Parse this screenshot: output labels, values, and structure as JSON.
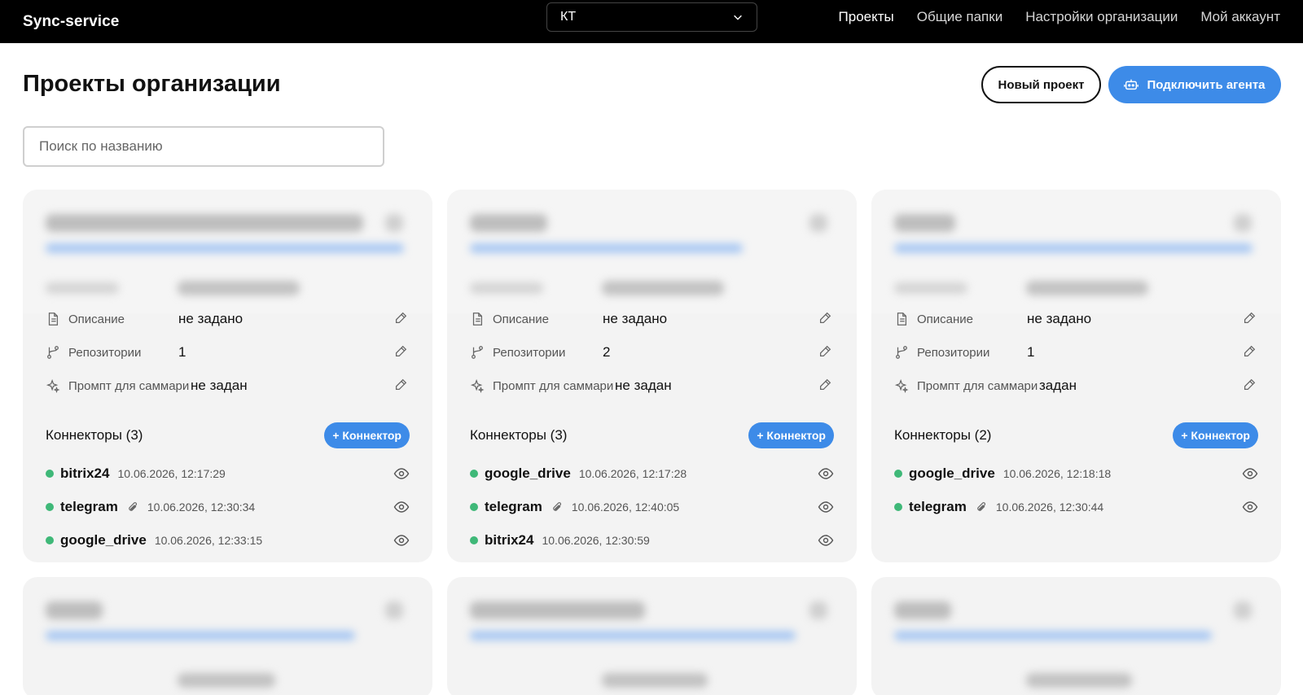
{
  "app": {
    "brand": "Sync-service"
  },
  "org_select": {
    "value": "КТ"
  },
  "nav": [
    {
      "label": "Проекты",
      "active": true
    },
    {
      "label": "Общие папки"
    },
    {
      "label": "Настройки организации"
    },
    {
      "label": "Мой аккаунт"
    }
  ],
  "page": {
    "title": "Проекты организации",
    "new_project_label": "Новый проект",
    "connect_agent_label": "Подключить агента",
    "search_placeholder": "Поиск по названию"
  },
  "card_labels": {
    "description": "Описание",
    "repositories": "Репозитории",
    "prompt": "Промпт для саммари",
    "add_connector": "+ Коннектор"
  },
  "projects": [
    {
      "description": "не задано",
      "repositories": "1",
      "prompt": "не задан",
      "connectors_title": "Коннекторы (3)",
      "connectors": [
        {
          "name": "bitrix24",
          "time": "10.06.2026, 12:17:29",
          "clip": false
        },
        {
          "name": "telegram",
          "time": "10.06.2026, 12:30:34",
          "clip": true
        },
        {
          "name": "google_drive",
          "time": "10.06.2026, 12:33:15",
          "clip": false
        }
      ]
    },
    {
      "description": "не задано",
      "repositories": "2",
      "prompt": "не задан",
      "connectors_title": "Коннекторы (3)",
      "connectors": [
        {
          "name": "google_drive",
          "time": "10.06.2026, 12:17:28",
          "clip": false
        },
        {
          "name": "telegram",
          "time": "10.06.2026, 12:40:05",
          "clip": true
        },
        {
          "name": "bitrix24",
          "time": "10.06.2026, 12:30:59",
          "clip": false
        }
      ]
    },
    {
      "description": "не задано",
      "repositories": "1",
      "prompt": "задан",
      "connectors_title": "Коннекторы (2)",
      "connectors": [
        {
          "name": "google_drive",
          "time": "10.06.2026, 12:18:18",
          "clip": false
        },
        {
          "name": "telegram",
          "time": "10.06.2026, 12:30:44",
          "clip": true
        }
      ]
    }
  ],
  "colors": {
    "accent": "#3d8be8",
    "status_ok": "#3fb878",
    "topbar": "#000000",
    "card_bg": "#f3f3f3"
  }
}
